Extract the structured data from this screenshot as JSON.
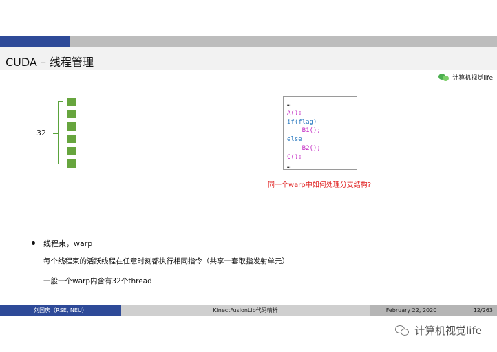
{
  "slide": {
    "title": "CUDA – 线程管理",
    "brand": "计算机视觉life"
  },
  "warp_diagram": {
    "label": "32",
    "thread_count_shown": 6
  },
  "code": {
    "lines": [
      "…",
      "A();",
      "if(flag)",
      "    B1();",
      "else",
      "    B2();",
      "C();",
      "…"
    ]
  },
  "question": "同一个warp中如何处理分支结构?",
  "bullets": {
    "main": "线程束，warp",
    "line1": "每个线程束的活跃线程在任意时刻都执行相同指令（共享一套取指发射单元）",
    "line2": "一般一个warp内含有32个thread"
  },
  "footer": {
    "author": "刘国庆（RSE, NEU）",
    "title": "KinectFusionLib代码精析",
    "date": "February 22, 2020",
    "page": "12/263"
  },
  "watermark": "计算机视觉life",
  "colors": {
    "accent": "#2e4a98",
    "thread": "#67a53e",
    "question": "#e01f1f"
  }
}
